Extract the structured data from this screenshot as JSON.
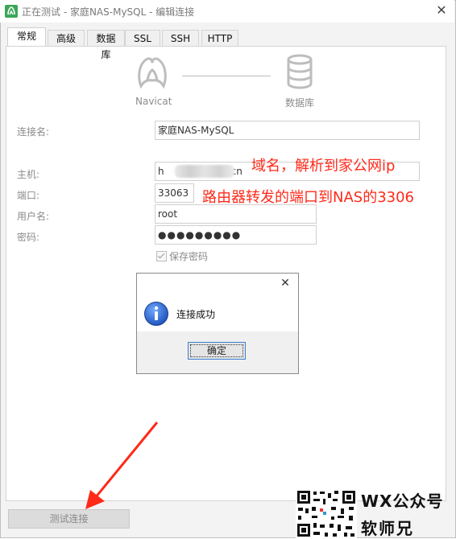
{
  "window": {
    "title": "正在测试 - 家庭NAS-MySQL - 编辑连接",
    "close_symbol": "✕"
  },
  "tabs": [
    {
      "label": "常规",
      "active": true
    },
    {
      "label": "高级",
      "active": false
    },
    {
      "label": "数据库",
      "active": false
    },
    {
      "label": "SSL",
      "active": false
    },
    {
      "label": "SSH",
      "active": false
    },
    {
      "label": "HTTP",
      "active": false
    }
  ],
  "diagram": {
    "left_label": "Navicat",
    "right_label": "数据库"
  },
  "form": {
    "connection_name_label": "连接名:",
    "connection_name_value": "家庭NAS-MySQL",
    "host_label": "主机:",
    "host_value_prefix": "h",
    "host_value_mid": "e.",
    "host_value_suffix": ".cn",
    "port_label": "端口:",
    "port_value": "33063",
    "username_label": "用户名:",
    "username_value": "root",
    "password_label": "密码:",
    "password_value": "●●●●●●●●●",
    "remember_label": "保存密码",
    "remember_checked": true
  },
  "annotations": {
    "domain_note": "域名，解析到家公网ip",
    "port_note": "路由器转发的端口到NAS的3306",
    "color": "#ff2a1a"
  },
  "dialog": {
    "message": "连接成功",
    "ok_label": "确定",
    "close_symbol": "✕",
    "icon": "info-icon"
  },
  "footer": {
    "test_connection_label": "测试连接"
  },
  "watermark": {
    "line1": "WX公众号",
    "line2": "软师兄"
  },
  "colors": {
    "accent_blue": "#3c7fd6",
    "annotation_red": "#ff2a1a"
  }
}
